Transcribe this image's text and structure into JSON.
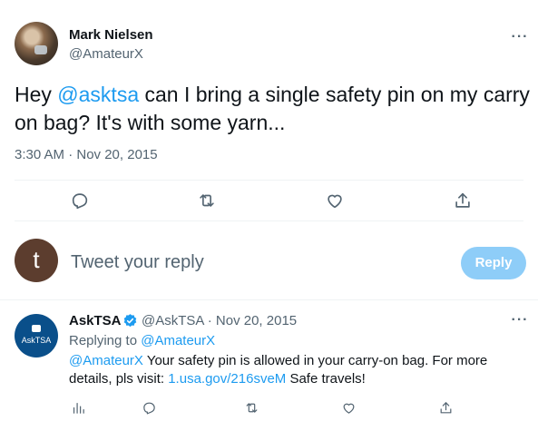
{
  "tweet": {
    "author_name": "Mark Nielsen",
    "author_handle": "@AmateurX",
    "text_prefix": "Hey ",
    "mention": "@asktsa",
    "text_suffix": " can I bring a single safety pin on my carry on bag? It's with some yarn...",
    "timestamp": "3:30 AM · Nov 20, 2015",
    "more_label": "···"
  },
  "actions": {
    "reply_icon": "reply-icon",
    "retweet_icon": "retweet-icon",
    "like_icon": "like-icon",
    "share_icon": "share-icon"
  },
  "composer": {
    "avatar_letter": "t",
    "placeholder": "Tweet your reply",
    "button_label": "Reply",
    "button_color": "#8ecdf8"
  },
  "reply": {
    "author_name": "AskTSA",
    "meta": "@AskTSA · Nov 20, 2015",
    "replying_prefix": "Replying to ",
    "replying_to": "@AmateurX",
    "mention": "@AmateurX",
    "text_mid": " Your safety pin is allowed in your carry-on bag. For more details, pls visit: ",
    "link": "1.usa.gov/216sveM",
    "text_end": " Safe travels!",
    "avatar_text": "AskTSA",
    "more_label": "···"
  },
  "colors": {
    "accent": "#1d9bf0",
    "muted": "#536471",
    "tsa_blue": "#0a4f8a"
  }
}
